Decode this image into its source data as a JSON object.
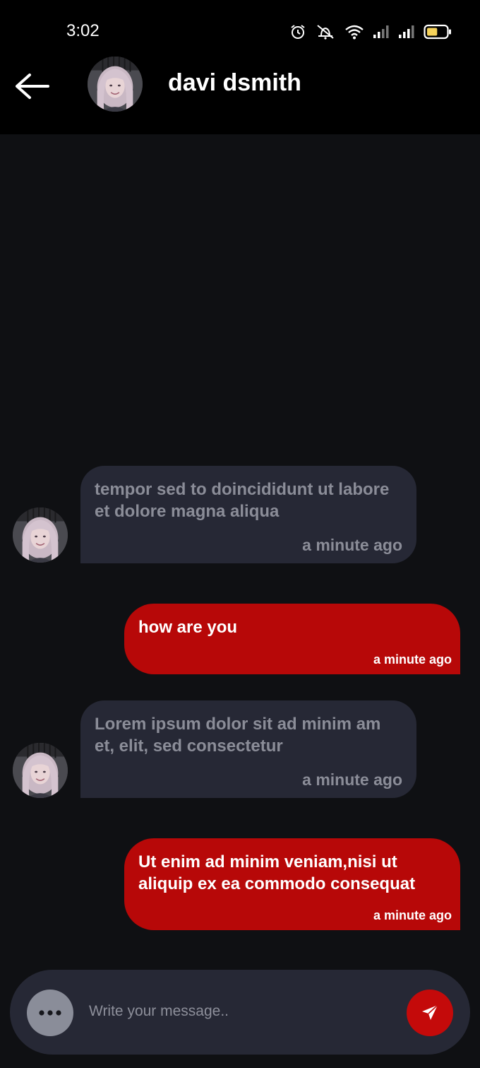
{
  "status_bar": {
    "time": "3:02",
    "icons": [
      "alarm-icon",
      "mute-icon",
      "wifi-icon",
      "signal-icon",
      "signal-icon",
      "battery-icon"
    ],
    "battery_level": 0.55,
    "battery_color": "#f5d25a"
  },
  "header": {
    "contact_name": "davi dsmith",
    "back_icon": "arrow-left-icon",
    "avatar": "contact-avatar"
  },
  "colors": {
    "background": "#0f1013",
    "header": "#000000",
    "incoming_bubble": "#262835",
    "outgoing_bubble": "#b70808",
    "send_button": "#c40a0a"
  },
  "messages": [
    {
      "direction": "incoming",
      "text": "tempor sed to doincididunt ut labore et dolore magna aliqua",
      "time": "a minute ago"
    },
    {
      "direction": "outgoing",
      "text": "how are you",
      "time": "a minute ago"
    },
    {
      "direction": "incoming",
      "text": "Lorem ipsum dolor sit ad minim am et, elit, sed consectetur",
      "time": "a minute ago"
    },
    {
      "direction": "outgoing",
      "text": "Ut enim ad minim veniam,nisi ut aliquip ex ea commodo consequat",
      "time": "a minute ago"
    }
  ],
  "composer": {
    "placeholder": "Write your message..",
    "value": "",
    "more_icon": "more-horizontal-icon",
    "send_icon": "send-icon"
  }
}
